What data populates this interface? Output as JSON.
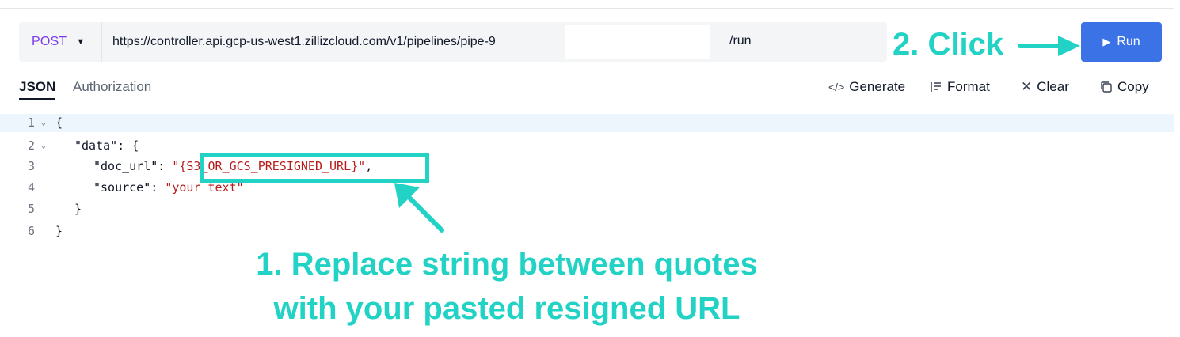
{
  "request": {
    "method": "POST",
    "url": "https://controller.api.gcp-us-west1.zillizcloud.com/v1/pipelines/pipe-9",
    "url_suffix": "/run",
    "run_label": "Run"
  },
  "tabs": [
    {
      "label": "JSON",
      "active": true
    },
    {
      "label": "Authorization",
      "active": false
    }
  ],
  "toolbar": {
    "generate": "Generate",
    "format": "Format",
    "clear": "Clear",
    "copy": "Copy"
  },
  "editor": {
    "lines": [
      {
        "n": "1",
        "parts": [
          "{"
        ]
      },
      {
        "n": "2",
        "parts": [
          "\"data\": {"
        ]
      },
      {
        "n": "3",
        "key": "\"doc_url\": ",
        "value": "\"{S3_OR_GCS_PRESIGNED_URL}\"",
        "tail": ","
      },
      {
        "n": "4",
        "key": "\"source\": ",
        "value": "\"your text\""
      },
      {
        "n": "5",
        "parts": [
          "}"
        ]
      },
      {
        "n": "6",
        "parts": [
          "}"
        ]
      }
    ]
  },
  "annotations": {
    "step_1_line_1": "1. Replace string between quotes",
    "step_1_line_2": "with your pasted resigned URL",
    "step_2": "2. Click"
  },
  "colors": {
    "accent_annotation": "#22d3c5",
    "run_button": "#3b72e6",
    "method": "#7c3aed",
    "string": "#b91c1c"
  }
}
